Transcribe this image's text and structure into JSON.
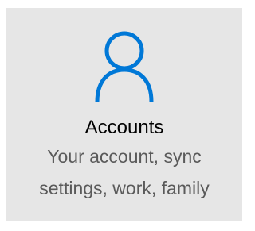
{
  "tile": {
    "title": "Accounts",
    "description_lines": [
      "Your account, sync",
      "settings, work, family"
    ],
    "icon": "person-icon",
    "accent_color": "#0078d7",
    "background_color": "#e6e6e6"
  }
}
